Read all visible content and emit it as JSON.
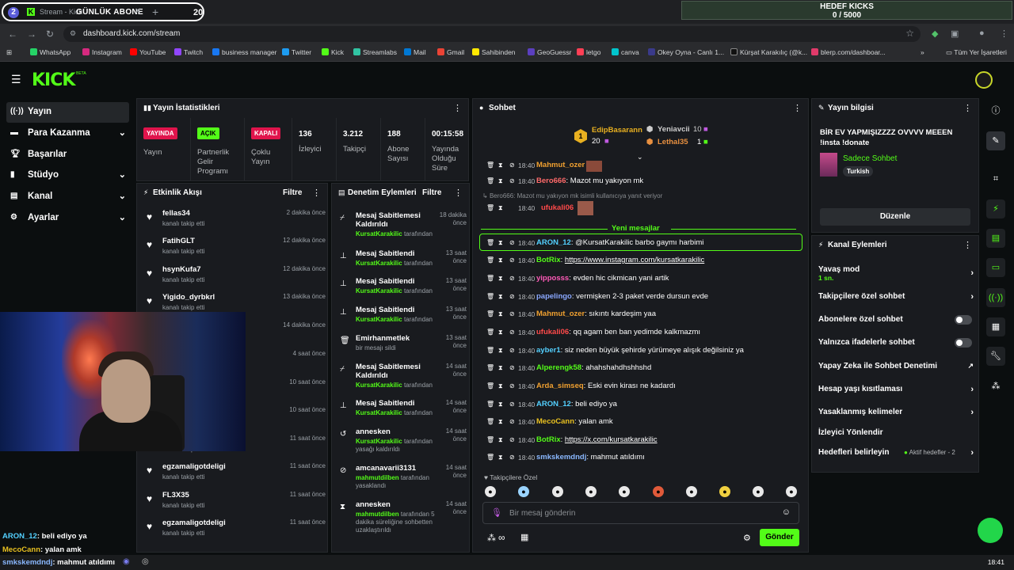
{
  "browser": {
    "tab_number": "2",
    "tab_title": "Stream - Kick",
    "goal_label": "GÜNLÜK ABONE",
    "goal_count": "20",
    "hedef_title": "HEDEF KICKS",
    "hedef_value": "0 / 5000",
    "url": "dashboard.kick.com/stream",
    "bookmarks": [
      "WhatsApp",
      "Instagram",
      "YouTube",
      "Twitch",
      "business manager",
      "Twitter",
      "Kick",
      "Streamlabs",
      "Mail",
      "Gmail",
      "Sahibinden",
      "GeoGuessr",
      "letgo",
      "canva",
      "Okey Oyna - Canlı 1...",
      "Kürşat Karakılıç (@k...",
      "blerp.com/dashboar..."
    ],
    "all_bookmarks": "Tüm Yer İşaretleri"
  },
  "header": {
    "logo": "KICK",
    "beta": "BETA"
  },
  "sidebar": {
    "items": [
      {
        "label": "Yayın"
      },
      {
        "label": "Para Kazanma"
      },
      {
        "label": "Başarılar"
      },
      {
        "label": "Stüdyo"
      },
      {
        "label": "Kanal"
      },
      {
        "label": "Ayarlar"
      }
    ]
  },
  "stats": {
    "title": "Yayın İstatistikleri",
    "live_badge": "YAYINDA",
    "live_label": "Yayın",
    "partner_badge": "AÇIK",
    "partner_label": "Partnerlik Gelir Programı",
    "multi_badge": "KAPALI",
    "multi_label": "Çoklu Yayın",
    "viewers": "136",
    "viewers_label": "İzleyici",
    "followers": "3.212",
    "followers_label": "Takipçi",
    "subs": "188",
    "subs_label": "Abone Sayısı",
    "uptime": "00:15:58",
    "uptime_label": "Yayında Olduğu Süre"
  },
  "events": {
    "title": "Etkinlik Akışı",
    "filter": "Filtre",
    "items": [
      {
        "name": "fellas34",
        "sub": "kanalı takip etti",
        "time": "2 dakika önce"
      },
      {
        "name": "FatihGLT",
        "sub": "kanalı takip etti",
        "time": "12 dakika önce"
      },
      {
        "name": "hsynKufa7",
        "sub": "kanalı takip etti",
        "time": "12 dakika önce"
      },
      {
        "name": "Yigido_dyrbkrl",
        "sub": "kanalı takip etti",
        "time": "13 dakika önce"
      },
      {
        "name": "",
        "sub": "",
        "time": "14 dakika önce"
      },
      {
        "name": "",
        "sub": "",
        "time": "4 saat önce"
      },
      {
        "name": "",
        "sub": "",
        "time": "10 saat önce"
      },
      {
        "name": "",
        "sub": "",
        "time": "10 saat önce"
      },
      {
        "name": "",
        "sub": "kanalı takip etti",
        "time": "11 saat önce"
      },
      {
        "name": "egzamaligotdeligi",
        "sub": "kanalı takip etti",
        "time": "11 saat önce"
      },
      {
        "name": "FL3X35",
        "sub": "kanalı takip etti",
        "time": "11 saat önce"
      },
      {
        "name": "egzamaligotdeligi",
        "sub": "kanalı takip etti",
        "time": "11 saat önce"
      }
    ]
  },
  "mod": {
    "title": "Denetim Eylemleri",
    "filter": "Filtre",
    "items": [
      {
        "title": "Mesaj Sabitlemesi Kaldırıldı",
        "time": "18 dakika önce",
        "user": "KursatKarakilic",
        "suffix": "tarafından"
      },
      {
        "title": "Mesaj Sabitlendi",
        "time": "13 saat önce",
        "user": "KursatKarakilic",
        "suffix": "tarafından"
      },
      {
        "title": "Mesaj Sabitlendi",
        "time": "13 saat önce",
        "user": "KursatKarakilic",
        "suffix": "tarafından"
      },
      {
        "title": "Mesaj Sabitlendi",
        "time": "13 saat önce",
        "user": "KursatKarakilic",
        "suffix": "tarafından"
      },
      {
        "title": "Emirhanmetlek",
        "time": "13 saat önce",
        "user": "",
        "suffix": "bir mesajı sildi"
      },
      {
        "title": "Mesaj Sabitlemesi Kaldırıldı",
        "time": "14 saat önce",
        "user": "KursatKarakilic",
        "suffix": "tarafından"
      },
      {
        "title": "Mesaj Sabitlendi",
        "time": "14 saat önce",
        "user": "KursatKarakilic",
        "suffix": "tarafından"
      },
      {
        "title": "annesken",
        "time": "14 saat önce",
        "user": "KursatKarakilic",
        "suffix": "tarafından yasağı kaldırıldı"
      },
      {
        "title": "amcanavarii3131",
        "time": "14 saat önce",
        "user": "mahmutdilben",
        "suffix": "tarafından yasaklandı"
      },
      {
        "title": "annesken",
        "time": "14 saat önce",
        "user": "mahmutdilben",
        "suffix": "tarafından 5 dakika süreliğine sohbetten uzaklaştırıldı"
      }
    ]
  },
  "chat": {
    "title": "Sohbet",
    "leaders": [
      {
        "name": "EdipBasarann",
        "count": "20",
        "rank": "1"
      },
      {
        "name": "Yeniavcii",
        "count": "10"
      },
      {
        "name": "Lethal35",
        "count": "1"
      }
    ],
    "top_rows": [
      {
        "time": "18:40",
        "user": "Mahmut_ozer",
        "color": "#f0a030",
        "text": ""
      },
      {
        "time": "18:40",
        "user": "Bero666",
        "color": "#ff6a6a",
        "text": "Mazot mu yakıyon mk"
      }
    ],
    "reply_note": "Bero666: Mazot mu yakıyon mk isimli kullanıcıya yanıt veriyor",
    "reply_row": {
      "time": "18:40",
      "user": "ufukali06",
      "color": "#ff4a4a"
    },
    "new_messages": "Yeni mesajlar",
    "messages": [
      {
        "time": "18:40",
        "user": "ARON_12",
        "color": "#53d0ff",
        "text": "@KursatKarakilic barbo gaymı harbimi"
      },
      {
        "time": "18:40",
        "user": "BotRix",
        "color": "#53fc18",
        "text": "https://www.instagram.com/kursatkarakilic"
      },
      {
        "time": "18:40",
        "user": "yipposss",
        "color": "#ff5ab8",
        "text": "evden hic cikmican yani artik"
      },
      {
        "time": "18:40",
        "user": "papelingo",
        "color": "#8aa8ff",
        "text": "vermişken 2-3 paket verde dursun evde"
      },
      {
        "time": "18:40",
        "user": "Mahmut_ozer",
        "color": "#f0a030",
        "text": "sıkıntı kardeşim yaa"
      },
      {
        "time": "18:40",
        "user": "ufukali06",
        "color": "#ff4a4a",
        "text": "qq agam ben ban yedimde kalkmazmı"
      },
      {
        "time": "18:40",
        "user": "ayber1",
        "color": "#53d0ff",
        "text": "siz neden büyük şehirde yürümeye alışık değilsiniz ya"
      },
      {
        "time": "18:40",
        "user": "Alperengk58",
        "color": "#53fc18",
        "text": "ahahshahdhshhshd"
      },
      {
        "time": "18:40",
        "user": "Arda_simseq",
        "color": "#f0a030",
        "text": "Eski evin kirası ne kadardı"
      },
      {
        "time": "18:40",
        "user": "ARON_12",
        "color": "#53d0ff",
        "text": "beli ediyo ya"
      },
      {
        "time": "18:40",
        "user": "MecoCann",
        "color": "#e8c020",
        "text": "yalan amk"
      },
      {
        "time": "18:40",
        "user": "BotRix",
        "color": "#53fc18",
        "text": "https://x.com/kursatkarakilic"
      },
      {
        "time": "18:40",
        "user": "smkskemdndj",
        "color": "#8ab8ff",
        "text": "mahmut atıldımı"
      }
    ],
    "follower_only": "Takipçilere Özel",
    "input_placeholder": "Bir mesaj gönderin",
    "send": "Gönder"
  },
  "info": {
    "title": "Yayın bilgisi",
    "stream_title": "BİR EV YAPMIŞIZZZZ OVVVV MEEEN !insta !donate",
    "category": "Sadece Sohbet",
    "tag": "Turkish",
    "edit": "Düzenle"
  },
  "channel": {
    "title": "Kanal Eylemleri",
    "slow_mode": "Yavaş mod",
    "slow_value": "1 sn.",
    "items": [
      {
        "label": "Takipçilere özel sohbet"
      },
      {
        "label": "Abonelere özel sohbet"
      },
      {
        "label": "Yalnızca ifadelerle sohbet"
      },
      {
        "label": "Yapay Zeka ile Sohbet Denetimi"
      },
      {
        "label": "Hesap yaşı kısıtlaması"
      },
      {
        "label": "Yasaklanmış kelimeler"
      },
      {
        "label": "İzleyici Yönlendir"
      },
      {
        "label": "Hedefleri belirleyin"
      }
    ],
    "goals_status": "Aktif hedefler - 2"
  },
  "overlay": {
    "lines": [
      {
        "user": "ARON_12",
        "text": ": beli ediyo ya"
      },
      {
        "user": "MecoCann",
        "text": ": yalan amk"
      },
      {
        "user": "smkskemdndj",
        "text": ": mahmut atıldımı"
      }
    ]
  },
  "taskbar": {
    "time": "18:41"
  }
}
